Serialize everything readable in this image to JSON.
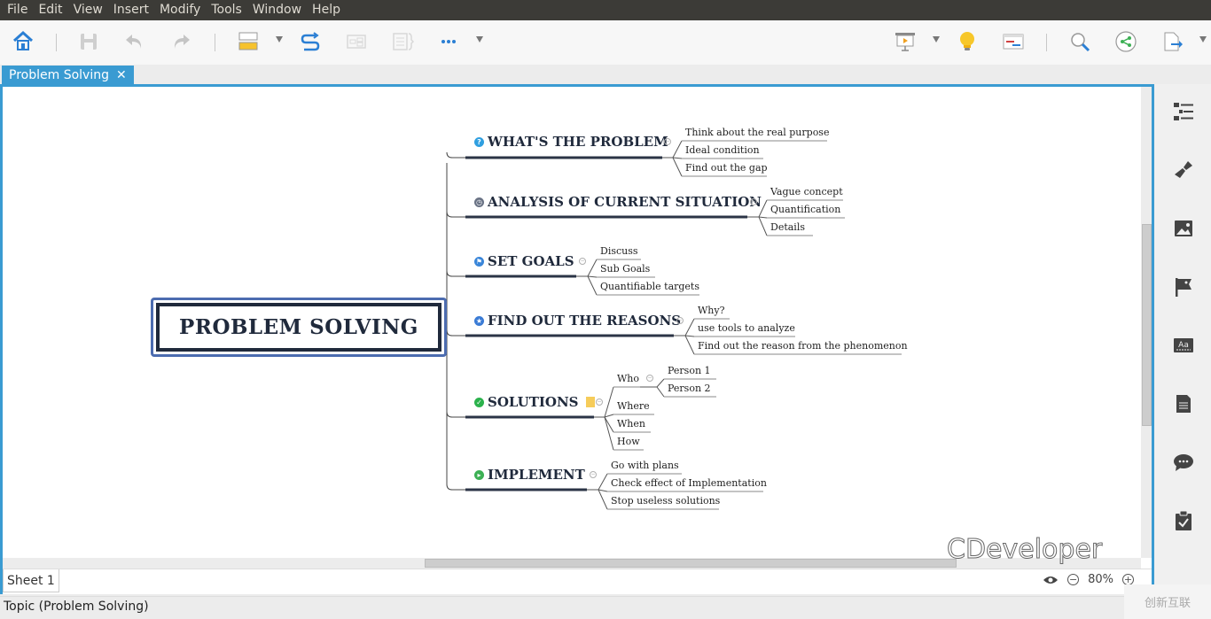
{
  "menubar": {
    "items": [
      "File",
      "Edit",
      "View",
      "Insert",
      "Modify",
      "Tools",
      "Window",
      "Help"
    ]
  },
  "toolbar": {
    "left": [
      {
        "name": "home",
        "icon": "home-icon"
      },
      {
        "name": "save",
        "icon": "save-icon"
      },
      {
        "name": "undo",
        "icon": "undo-icon"
      },
      {
        "name": "redo",
        "icon": "redo-icon"
      },
      {
        "name": "topic",
        "icon": "topic-icon"
      },
      {
        "name": "relationship",
        "icon": "relationship-icon"
      },
      {
        "name": "boundary",
        "icon": "boundary-icon"
      },
      {
        "name": "summary",
        "icon": "summary-icon"
      },
      {
        "name": "more",
        "icon": "more-icon"
      }
    ],
    "right": [
      {
        "name": "presentation",
        "icon": "presentation-icon"
      },
      {
        "name": "brainstorm",
        "icon": "lightbulb-icon"
      },
      {
        "name": "gantt",
        "icon": "gantt-icon"
      },
      {
        "name": "search",
        "icon": "search-icon"
      },
      {
        "name": "share",
        "icon": "share-icon"
      },
      {
        "name": "export",
        "icon": "export-icon"
      }
    ]
  },
  "tab": {
    "label": "Problem Solving",
    "close": "✕"
  },
  "mindmap": {
    "central": "PROBLEM SOLVING",
    "topics": [
      {
        "label": "WHAT'S THE PROBLEM",
        "marker": "?",
        "marker_color": "#2f9fe0",
        "children": [
          "Think about the real purpose",
          "Ideal condition",
          "Find out the gap"
        ]
      },
      {
        "label": "ANALYSIS OF CURRENT SITUATION",
        "marker": "◷",
        "marker_color": "#6a7385",
        "children": [
          "Vague concept",
          "Quantification",
          "Details"
        ]
      },
      {
        "label": "SET GOALS",
        "marker": "⚑",
        "marker_color": "#3a86d9",
        "children": [
          "Discuss",
          "Sub Goals",
          "Quantifiable targets"
        ]
      },
      {
        "label": "FIND OUT THE REASONS",
        "marker": "★",
        "marker_color": "#3a7bd5",
        "children": [
          "Why?",
          "use tools to analyze",
          "Find out the reason from the phenomenon"
        ]
      },
      {
        "label": "SOLUTIONS",
        "marker": "✓",
        "marker_color": "#2bb24c",
        "children": [
          "Who",
          "Where",
          "When",
          "How"
        ],
        "who_children": [
          "Person 1",
          "Person 2"
        ]
      },
      {
        "label": "IMPLEMENT",
        "marker": "▸",
        "marker_color": "#3cb054",
        "children": [
          "Go with plans",
          "Check effect of Implementation",
          "Stop useless solutions"
        ]
      }
    ]
  },
  "sheet": {
    "label": "Sheet 1"
  },
  "zoom": {
    "level": "80%",
    "minus": "−",
    "plus": "+"
  },
  "status": {
    "text": "Topic (Problem Solving)"
  },
  "watermark": {
    "text": "CDeveloper",
    "logo_text": "创新互联"
  }
}
